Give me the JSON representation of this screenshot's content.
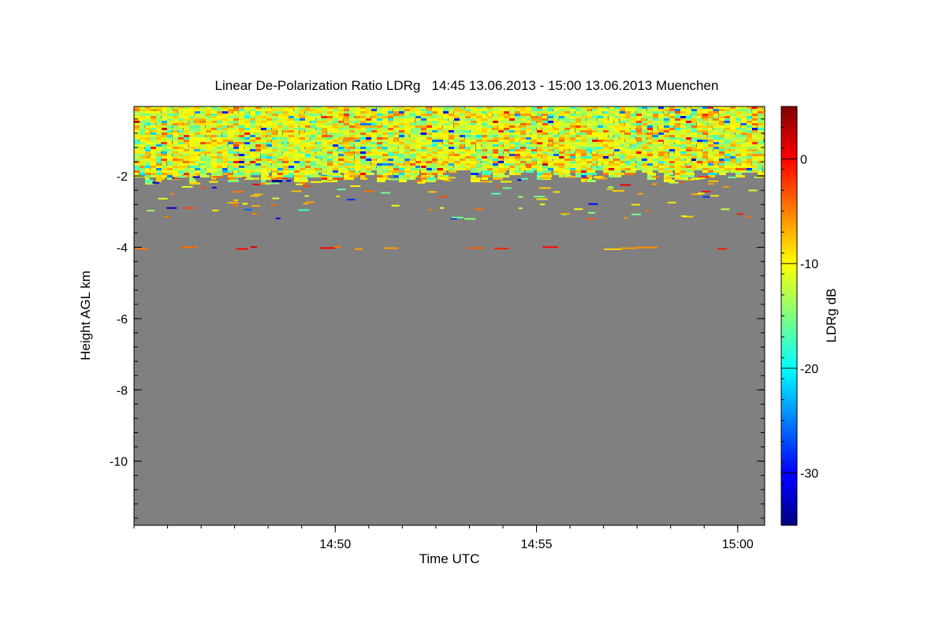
{
  "chart_data": {
    "type": "heatmap",
    "title": "Linear De-Polarization Ratio LDRg   14:45 13.06.2013 - 15:00 13.06.2013 Muenchen",
    "xlabel": "Time UTC",
    "ylabel": "Height AGL km",
    "x_range_minutes": [
      0,
      15.67
    ],
    "x_ticks": [
      {
        "value": 5,
        "label": "14:50"
      },
      {
        "value": 10,
        "label": "14:55"
      },
      {
        "value": 15,
        "label": "15:00"
      }
    ],
    "x_minor_step_minutes": 0.8333,
    "ylim": [
      -11.8,
      -0.05
    ],
    "y_ticks": [
      {
        "value": -2,
        "label": "-2"
      },
      {
        "value": -4,
        "label": "-4"
      },
      {
        "value": -6,
        "label": "-6"
      },
      {
        "value": -8,
        "label": "-8"
      },
      {
        "value": -10,
        "label": "-10"
      }
    ],
    "y_minor_step": 0.4,
    "background_color": "#808080",
    "colorbar": {
      "label": "LDRg dB",
      "range": [
        -35,
        5
      ],
      "ticks": [
        {
          "value": 0,
          "label": "0"
        },
        {
          "value": -10,
          "label": "-10"
        },
        {
          "value": -20,
          "label": "-20"
        },
        {
          "value": -30,
          "label": "-30"
        }
      ],
      "minor_step": 2,
      "colormap": "jet"
    },
    "data_layers": [
      {
        "name": "boundary layer",
        "top_km": -0.1,
        "bottom_km": -2.0,
        "median_db": -11,
        "spread_db": 3
      },
      {
        "name": "scattered returns",
        "top_km": -2.0,
        "bottom_km": -3.3,
        "median_db": -8
      },
      {
        "name": "layer near -4 km",
        "height_km": -4.0,
        "median_db": -3
      }
    ]
  }
}
